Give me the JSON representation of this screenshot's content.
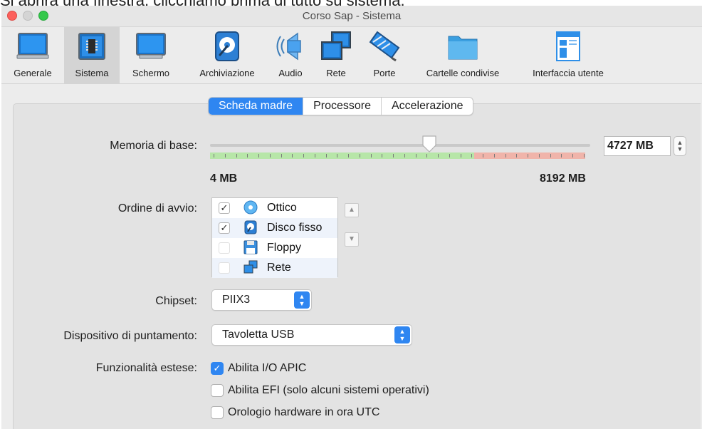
{
  "top_text": "Si aprirà una finestra, clicchiamo prima di tutto su sistema.",
  "window": {
    "title": "Corso Sap - Sistema"
  },
  "toolbar": {
    "items": [
      {
        "label": "Generale"
      },
      {
        "label": "Sistema"
      },
      {
        "label": "Schermo"
      },
      {
        "label": "Archiviazione"
      },
      {
        "label": "Audio"
      },
      {
        "label": "Rete"
      },
      {
        "label": "Porte"
      },
      {
        "label": "Cartelle condivise"
      },
      {
        "label": "Interfaccia utente"
      }
    ],
    "selected": "Sistema"
  },
  "tabs": {
    "items": [
      "Scheda madre",
      "Processore",
      "Accelerazione"
    ],
    "active": "Scheda madre"
  },
  "memory": {
    "label": "Memoria di base:",
    "value": "4727 MB",
    "min_label": "4 MB",
    "max_label": "8192 MB",
    "slider_fraction": 0.577
  },
  "boot": {
    "label": "Ordine di avvio:",
    "items": [
      {
        "name": "Ottico",
        "checked": true,
        "icon": "optical-disc-icon"
      },
      {
        "name": "Disco fisso",
        "checked": true,
        "icon": "hard-disk-icon"
      },
      {
        "name": "Floppy",
        "checked": false,
        "icon": "floppy-icon"
      },
      {
        "name": "Rete",
        "checked": false,
        "icon": "network-icon"
      }
    ]
  },
  "chipset": {
    "label": "Chipset:",
    "value": "PIIX3"
  },
  "pointing": {
    "label": "Dispositivo di puntamento:",
    "value": "Tavoletta USB"
  },
  "extended": {
    "label": "Funzionalità estese:",
    "options": [
      {
        "label": "Abilita I/O APIC",
        "checked": true
      },
      {
        "label": "Abilita EFI (solo alcuni sistemi operativi)",
        "checked": false
      },
      {
        "label": "Orologio hardware in ora UTC",
        "checked": false
      }
    ]
  },
  "colors": {
    "accent": "#2f86f1",
    "scale_green": "#b7e6a8",
    "scale_red": "#f0b4aa"
  }
}
